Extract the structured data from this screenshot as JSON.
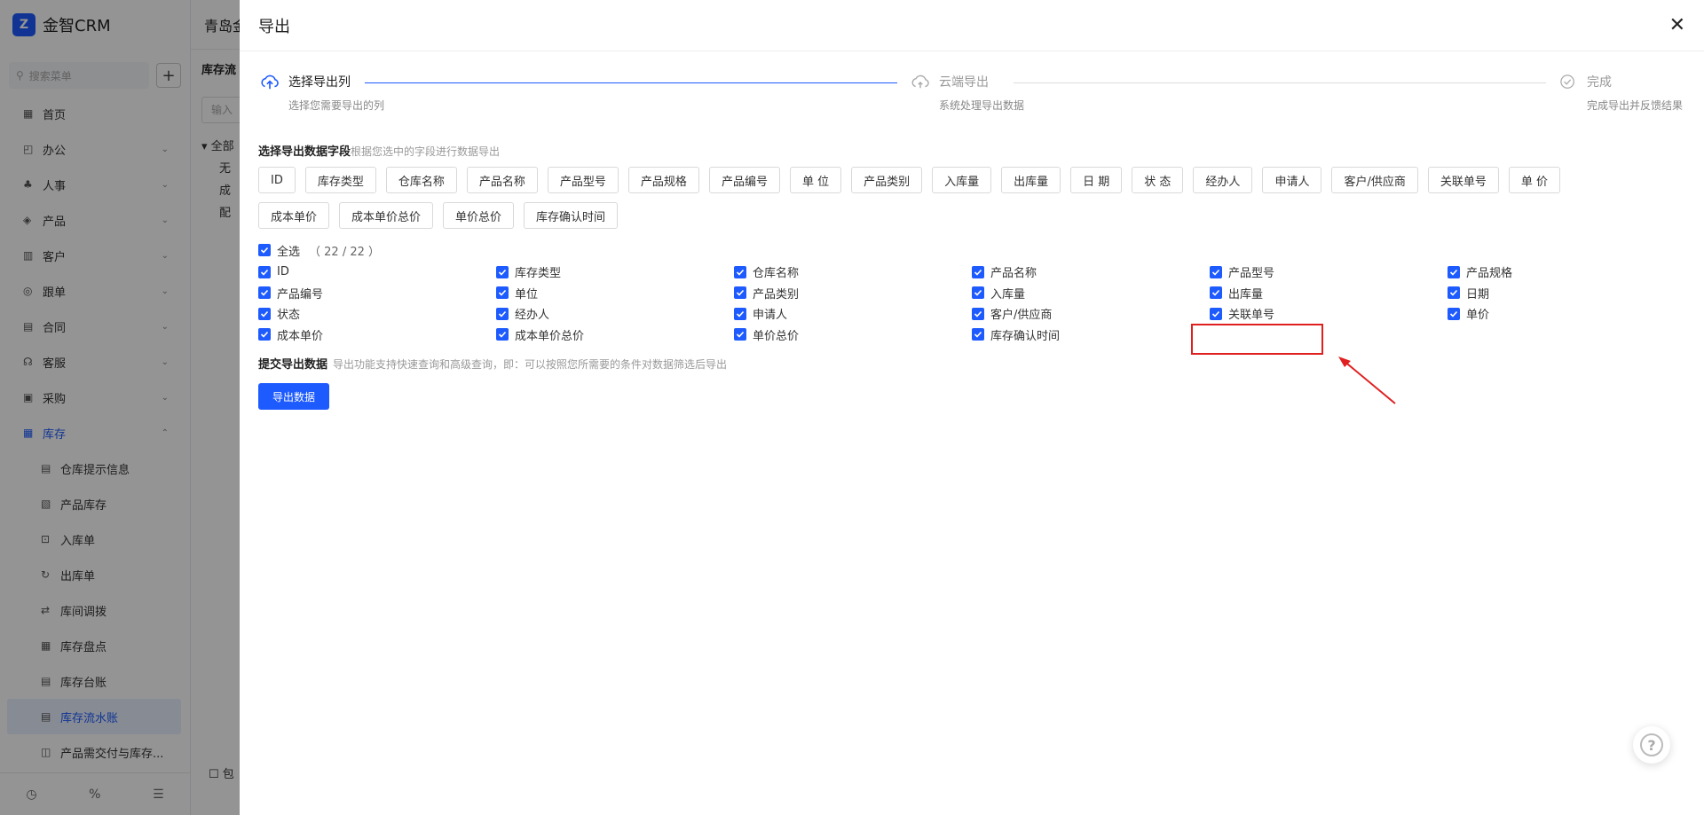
{
  "app": {
    "logo_mark": "Z",
    "name": "金智CRM"
  },
  "sidebar": {
    "search_placeholder": "搜索菜单",
    "add_label": "+",
    "items": [
      {
        "icon": "home-icon",
        "glyph": "▦",
        "label": "首页",
        "chevron": ""
      },
      {
        "icon": "office-icon",
        "glyph": "◰",
        "label": "办公",
        "chevron": "⌄"
      },
      {
        "icon": "hr-icon",
        "glyph": "♣",
        "label": "人事",
        "chevron": "⌄"
      },
      {
        "icon": "product-icon",
        "glyph": "◈",
        "label": "产品",
        "chevron": "⌄"
      },
      {
        "icon": "customer-icon",
        "glyph": "▥",
        "label": "客户",
        "chevron": "⌄"
      },
      {
        "icon": "follow-icon",
        "glyph": "◎",
        "label": "跟单",
        "chevron": "⌄"
      },
      {
        "icon": "contract-icon",
        "glyph": "▤",
        "label": "合同",
        "chevron": "⌄"
      },
      {
        "icon": "service-icon",
        "glyph": "☊",
        "label": "客服",
        "chevron": "⌄"
      },
      {
        "icon": "purchase-icon",
        "glyph": "▣",
        "label": "采购",
        "chevron": "⌄"
      },
      {
        "icon": "inventory-icon",
        "glyph": "▦",
        "label": "库存",
        "chevron": "⌃"
      }
    ],
    "sub_items": [
      {
        "icon": "warehouse-alert-icon",
        "glyph": "▤",
        "label": "仓库提示信息"
      },
      {
        "icon": "product-stock-icon",
        "glyph": "▧",
        "label": "产品库存"
      },
      {
        "icon": "stock-in-icon",
        "glyph": "⊡",
        "label": "入库单"
      },
      {
        "icon": "stock-out-icon",
        "glyph": "↻",
        "label": "出库单"
      },
      {
        "icon": "transfer-icon",
        "glyph": "⇄",
        "label": "库间调拨"
      },
      {
        "icon": "stocktake-icon",
        "glyph": "▦",
        "label": "库存盘点"
      },
      {
        "icon": "ledger-icon",
        "glyph": "▤",
        "label": "库存台账"
      },
      {
        "icon": "flow-ledger-icon",
        "glyph": "▤",
        "label": "库存流水账"
      },
      {
        "icon": "delivery-icon",
        "glyph": "◫",
        "label": "产品需交付与库存..."
      }
    ],
    "footer": [
      "◷",
      "%",
      "☰"
    ]
  },
  "background": {
    "header_title": "青岛金",
    "panel_title": "库存流",
    "input_placeholder": "输入",
    "tree": [
      "▾ 全部",
      "无",
      "成",
      "配"
    ],
    "bottom_check": "☐ 包"
  },
  "modal": {
    "title": "导出",
    "close": "✕",
    "steps": [
      {
        "title": "选择导出列",
        "desc": "选择您需要导出的列"
      },
      {
        "title": "云端导出",
        "desc": "系统处理导出数据"
      },
      {
        "title": "完成",
        "desc": "完成导出并反馈结果"
      }
    ],
    "field_section": {
      "title": "选择导出数据字段",
      "hint": "根据您选中的字段进行数据导出"
    },
    "chips": [
      "ID",
      "库存类型",
      "仓库名称",
      "产品名称",
      "产品型号",
      "产品规格",
      "产品编号",
      "单 位",
      "产品类别",
      "入库量",
      "出库量",
      "日 期",
      "状 态",
      "经办人",
      "申请人",
      "客户/供应商",
      "关联单号",
      "单 价",
      "成本单价",
      "成本单价总价",
      "单价总价",
      "库存确认时间"
    ],
    "select_all": {
      "label": "全选",
      "count": "（ 22 / 22 ）"
    },
    "checkboxes": [
      "ID",
      "库存类型",
      "仓库名称",
      "产品名称",
      "产品型号",
      "产品规格",
      "产品编号",
      "单位",
      "产品类别",
      "入库量",
      "出库量",
      "日期",
      "状态",
      "经办人",
      "申请人",
      "客户/供应商",
      "关联单号",
      "单价",
      "成本单价",
      "成本单价总价",
      "单价总价",
      "库存确认时间"
    ],
    "submit_section": {
      "title": "提交导出数据",
      "hint": "导出功能支持快速查询和高级查询，即：可以按照您所需要的条件对数据筛选后导出"
    },
    "export_button": "导出数据",
    "help": "?"
  },
  "colors": {
    "primary": "#1e5bff",
    "annotation": "#e02020"
  }
}
